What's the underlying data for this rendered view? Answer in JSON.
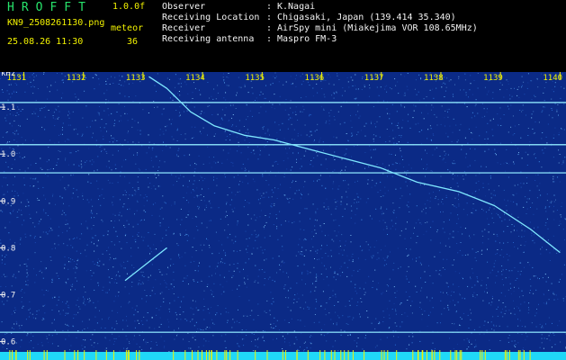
{
  "header": {
    "app_title": "HROFFT",
    "version": "1.0.0f",
    "filename": "KN9_2508261130.png",
    "timestamp": "25.08.26 11:30",
    "meteor_label": "meteor",
    "meteor_count": "36"
  },
  "info": [
    {
      "label": "Observer",
      "value": "K.Nagai"
    },
    {
      "label": "Receiving Location",
      "value": "Chigasaki, Japan (139.414 35.340)"
    },
    {
      "label": "Receiver",
      "value": "AirSpy mini (Miakejima VOR 108.65MHz)"
    },
    {
      "label": "Receiving antenna",
      "value": "Maspro FM-3"
    }
  ],
  "info_separator": ":",
  "colors": {
    "background": "#000000",
    "spectrogram": "#0b2a86",
    "title": "#27e36b",
    "tick": "#f2f200",
    "signal": "#7fe8ff"
  },
  "chart_data": {
    "type": "heatmap",
    "y_unit": "kHz",
    "x_ticks": [
      "1131",
      "1132",
      "1133",
      "1134",
      "1135",
      "1136",
      "1137",
      "1138",
      "1139",
      "1140"
    ],
    "y_ticks": [
      "1.1",
      "1.0",
      "0.9",
      "0.8",
      "0.7",
      "0.6"
    ],
    "x_range": [
      1130.6,
      1140.1
    ],
    "y_range": [
      0.58,
      1.175
    ],
    "carriers_khz": [
      1.11,
      1.02,
      0.96,
      0.62
    ],
    "meteor_traces": [
      {
        "points": [
          [
            1133.1,
            1.165
          ],
          [
            1133.4,
            1.14
          ],
          [
            1133.8,
            1.09
          ],
          [
            1134.2,
            1.06
          ],
          [
            1134.7,
            1.04
          ],
          [
            1135.2,
            1.03
          ],
          [
            1135.8,
            1.01
          ],
          [
            1136.4,
            0.99
          ],
          [
            1137.0,
            0.97
          ],
          [
            1137.6,
            0.94
          ],
          [
            1138.3,
            0.92
          ],
          [
            1138.9,
            0.89
          ],
          [
            1139.5,
            0.84
          ],
          [
            1140.0,
            0.79
          ]
        ]
      },
      {
        "points": [
          [
            1132.7,
            0.73
          ],
          [
            1133.4,
            0.8
          ]
        ]
      }
    ]
  }
}
